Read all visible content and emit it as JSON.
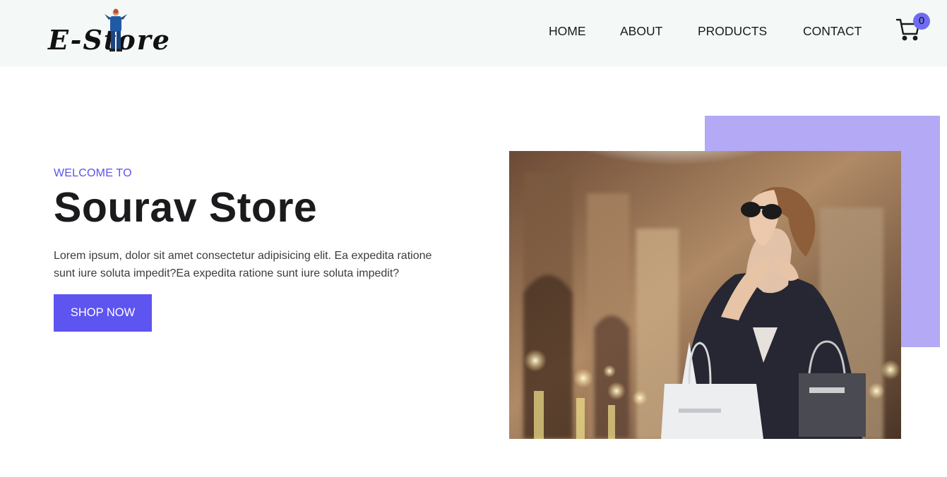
{
  "brand": {
    "logo_text": "E-Store",
    "logo_icon": "person-figure-icon"
  },
  "nav": {
    "items": [
      {
        "label": "HOME"
      },
      {
        "label": "ABOUT"
      },
      {
        "label": "PRODUCTS"
      },
      {
        "label": "CONTACT"
      }
    ],
    "cart_icon": "shopping-cart-icon",
    "cart_count": "0"
  },
  "hero": {
    "kicker": "WELCOME TO",
    "title": "Sourav Store",
    "description": "Lorem ipsum, dolor sit amet consectetur adipisicing elit. Ea expedita ratione sunt iure soluta impedit?Ea expedita ratione sunt iure soluta impedit?",
    "cta_label": "SHOP NOW",
    "image": "woman-with-shopping-bags-photo"
  },
  "colors": {
    "accent": "#5e54f0",
    "accent_light": "#b3a9f4",
    "nav_background": "#f4f8f7",
    "badge": "#6f6cf3"
  }
}
